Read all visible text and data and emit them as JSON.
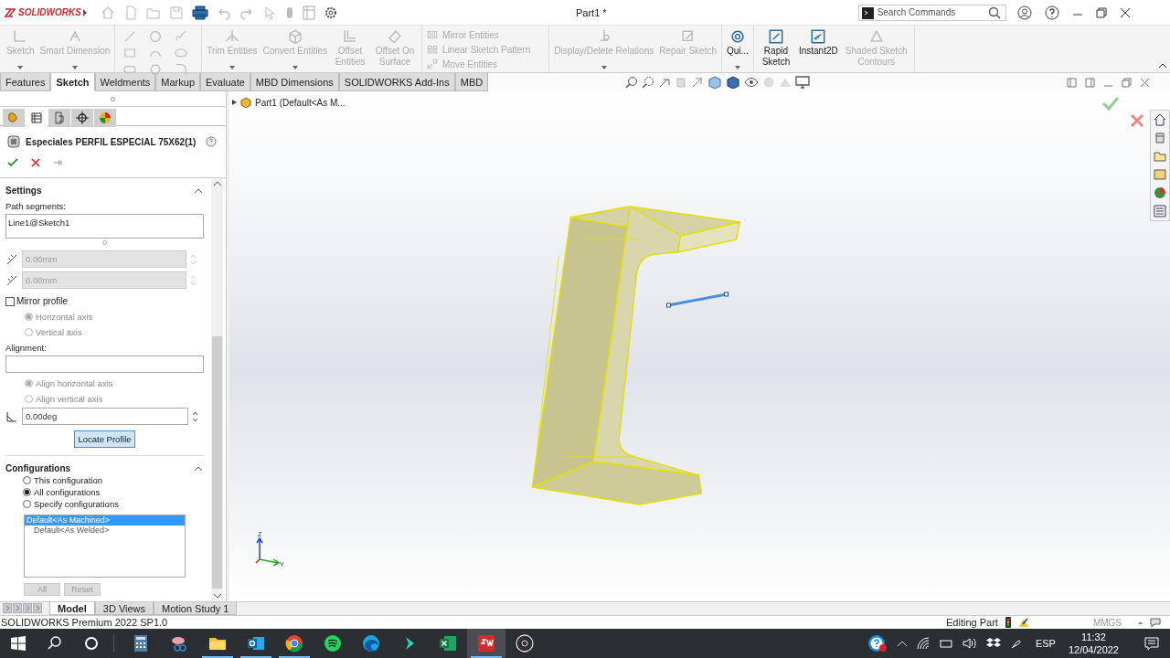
{
  "app": {
    "logo": "SOLIDWORKS",
    "title": "Part1 *",
    "search_placeholder": "Search Commands"
  },
  "ribbon_groups": [
    {
      "kind": "large",
      "items": [
        {
          "label": "Sketch",
          "disabled": true,
          "dropdown": true
        },
        {
          "label": "Smart Dimension",
          "disabled": true,
          "dropdown": true
        }
      ]
    },
    {
      "kind": "entities"
    },
    {
      "kind": "large",
      "items": [
        {
          "label": "Trim Entities",
          "disabled": true,
          "dropdown": true
        },
        {
          "label": "Convert Entities",
          "disabled": true,
          "dropdown": true
        },
        {
          "label": "Offset Entities",
          "disabled": true,
          "dropdown": false
        },
        {
          "label": "Offset On Surface",
          "disabled": true,
          "dropdown": false
        }
      ]
    },
    {
      "kind": "stack",
      "items": [
        {
          "label": "Mirror Entities",
          "disabled": true
        },
        {
          "label": "Linear Sketch Pattern",
          "disabled": true
        },
        {
          "label": "Move Entities",
          "disabled": true
        }
      ]
    },
    {
      "kind": "large",
      "items": [
        {
          "label": "Display/Delete Relations",
          "disabled": true,
          "dropdown": true
        },
        {
          "label": "Repair Sketch",
          "disabled": true,
          "dropdown": false
        }
      ]
    },
    {
      "kind": "large",
      "items": [
        {
          "label": "Qui...",
          "disabled": false,
          "dropdown": true
        }
      ]
    },
    {
      "kind": "large",
      "items": [
        {
          "label": "Rapid Sketch",
          "disabled": false,
          "dropdown": false
        },
        {
          "label": "Instant2D",
          "disabled": false,
          "dropdown": false
        },
        {
          "label": "Shaded Sketch Contours",
          "disabled": true,
          "dropdown": false
        }
      ]
    }
  ],
  "tabs": [
    {
      "label": "Features",
      "selected": false
    },
    {
      "label": "Sketch",
      "selected": true
    },
    {
      "label": "Weldments",
      "selected": false
    },
    {
      "label": "Markup",
      "selected": false
    },
    {
      "label": "Evaluate",
      "selected": false
    },
    {
      "label": "MBD Dimensions",
      "selected": false
    },
    {
      "label": "SOLIDWORKS Add-Ins",
      "selected": false
    },
    {
      "label": "MBD",
      "selected": false
    }
  ],
  "tree": {
    "label": "Part1  (Default<As M..."
  },
  "triad": {
    "z": "Z",
    "y": "Y"
  },
  "property_manager": {
    "title": "Especiales PERFIL ESPECIAL 75X62(1)",
    "settings": {
      "heading": "Settings",
      "path_label": "Path segments:",
      "path_value": "Line1@Sketch1",
      "offsets": [
        {
          "value": "0.00mm",
          "disabled": true
        },
        {
          "value": "0.00mm",
          "disabled": true
        }
      ],
      "mirror": {
        "label": "Mirror profile",
        "checked": false
      },
      "mirror_axes": [
        {
          "label": "Horizontal axis",
          "selected": true,
          "disabled": true
        },
        {
          "label": "Vertical axis",
          "selected": false,
          "disabled": true
        }
      ],
      "alignment_label": "Alignment:",
      "align_axes": [
        {
          "label": "Align horizontal axis",
          "selected": true,
          "disabled": true
        },
        {
          "label": "Align vertical axis",
          "selected": false,
          "disabled": true
        }
      ],
      "angle": "0.00deg",
      "locate_button": "Locate Profile"
    },
    "configurations": {
      "heading": "Configurations",
      "options": [
        {
          "label": "This configuration",
          "selected": false
        },
        {
          "label": "All configurations",
          "selected": true
        },
        {
          "label": "Specify configurations",
          "selected": false
        }
      ],
      "list": [
        {
          "label": "Default<As Machined>",
          "selected": true
        },
        {
          "label": "Default<As Welded>",
          "selected": false
        }
      ],
      "buttons": [
        {
          "label": "All",
          "disabled": true
        },
        {
          "label": "Reset",
          "disabled": true
        }
      ]
    }
  },
  "bottom_tabs": [
    {
      "label": "Model",
      "selected": true
    },
    {
      "label": "3D Views",
      "selected": false
    },
    {
      "label": "Motion Study 1",
      "selected": false
    }
  ],
  "status_bar": {
    "product": "SOLIDWORKS Premium 2022 SP1.0",
    "mode": "Editing Part",
    "units": "MMGS"
  },
  "taskbar": {
    "apps": [
      {
        "running": false,
        "selected": false
      },
      {
        "running": false,
        "selected": false
      },
      {
        "running": true,
        "selected": false
      },
      {
        "running": true,
        "selected": false
      },
      {
        "running": true,
        "selected": false
      },
      {
        "running": false,
        "selected": false
      },
      {
        "running": false,
        "selected": false
      },
      {
        "running": false,
        "selected": false
      },
      {
        "running": false,
        "selected": false
      },
      {
        "running": true,
        "selected": true
      },
      {
        "running": false,
        "selected": false
      }
    ],
    "language": "ESP",
    "time": "11:32",
    "date": "12/04/2022"
  }
}
